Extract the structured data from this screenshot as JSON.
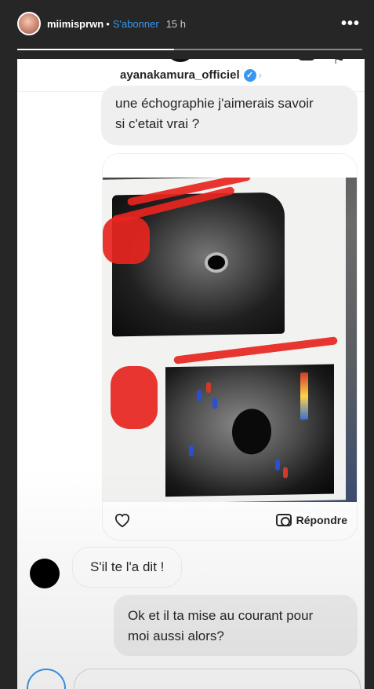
{
  "story": {
    "username": "miimisprwn",
    "dot": "•",
    "subscribe_label": "S'abonner",
    "time": "15 h",
    "more_label": "•••"
  },
  "dm": {
    "header_name": "ayanakamura_officiel",
    "verified_mark": "✓",
    "chevron": "›",
    "messages": [
      {
        "text_line1": "une échographie j'aimerais savoir",
        "text_line2": "si c'etait vrai ?"
      },
      {
        "text": "S'il te l'a dit !"
      },
      {
        "text_line1": "Ok et il ta mise au courant pour",
        "text_line2": "moi aussi alors?"
      }
    ],
    "reply_label": "Répondre"
  },
  "colors": {
    "accent": "#3897f0",
    "background": "#262626",
    "bubble_gray": "#efefef",
    "scribble_red": "#e8251f"
  }
}
